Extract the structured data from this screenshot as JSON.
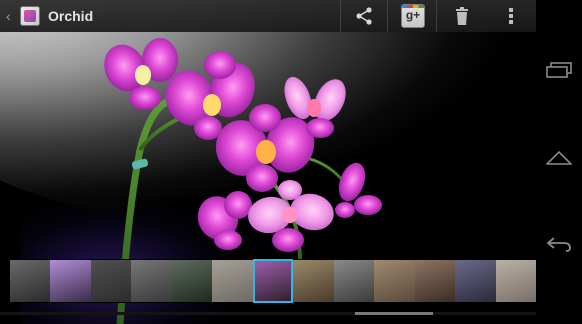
{
  "app": {
    "title": "Orchid"
  },
  "actionbar": {
    "share_icon": "share-icon",
    "gplus_label": "g+",
    "delete_icon": "trash-icon",
    "overflow_icon": "overflow-menu-icon"
  },
  "filmstrip": {
    "thumbnails": [
      {
        "colors": [
          "#2a2a2a",
          "#6b6b6b"
        ]
      },
      {
        "colors": [
          "#3a2b4a",
          "#b28ed6"
        ]
      },
      {
        "colors": [
          "#2c2c2c",
          "#505050"
        ]
      },
      {
        "colors": [
          "#393939",
          "#777777"
        ]
      },
      {
        "colors": [
          "#1f2a1f",
          "#5e6b5e"
        ]
      },
      {
        "colors": [
          "#6e6a62",
          "#a5a098"
        ]
      },
      {
        "colors": [
          "#2a1f2a",
          "#a45fb0"
        ]
      },
      {
        "colors": [
          "#4a3a2a",
          "#9a8a6a"
        ]
      },
      {
        "colors": [
          "#3b3b3b",
          "#8a8a8a"
        ]
      },
      {
        "colors": [
          "#5a4a3a",
          "#a08a70"
        ]
      },
      {
        "colors": [
          "#3a2c24",
          "#8f7564"
        ]
      },
      {
        "colors": [
          "#2a2a3a",
          "#6a6a8a"
        ]
      },
      {
        "colors": [
          "#7a6f66",
          "#b9b0a6"
        ]
      }
    ],
    "selected_index": 6
  },
  "navbar": {
    "recent_icon": "recent-apps-icon",
    "home_icon": "home-icon",
    "back_icon": "back-icon"
  },
  "colors": {
    "accent": "#33b5e5",
    "flower": "#d43ad8",
    "stem": "#6aa83a"
  }
}
